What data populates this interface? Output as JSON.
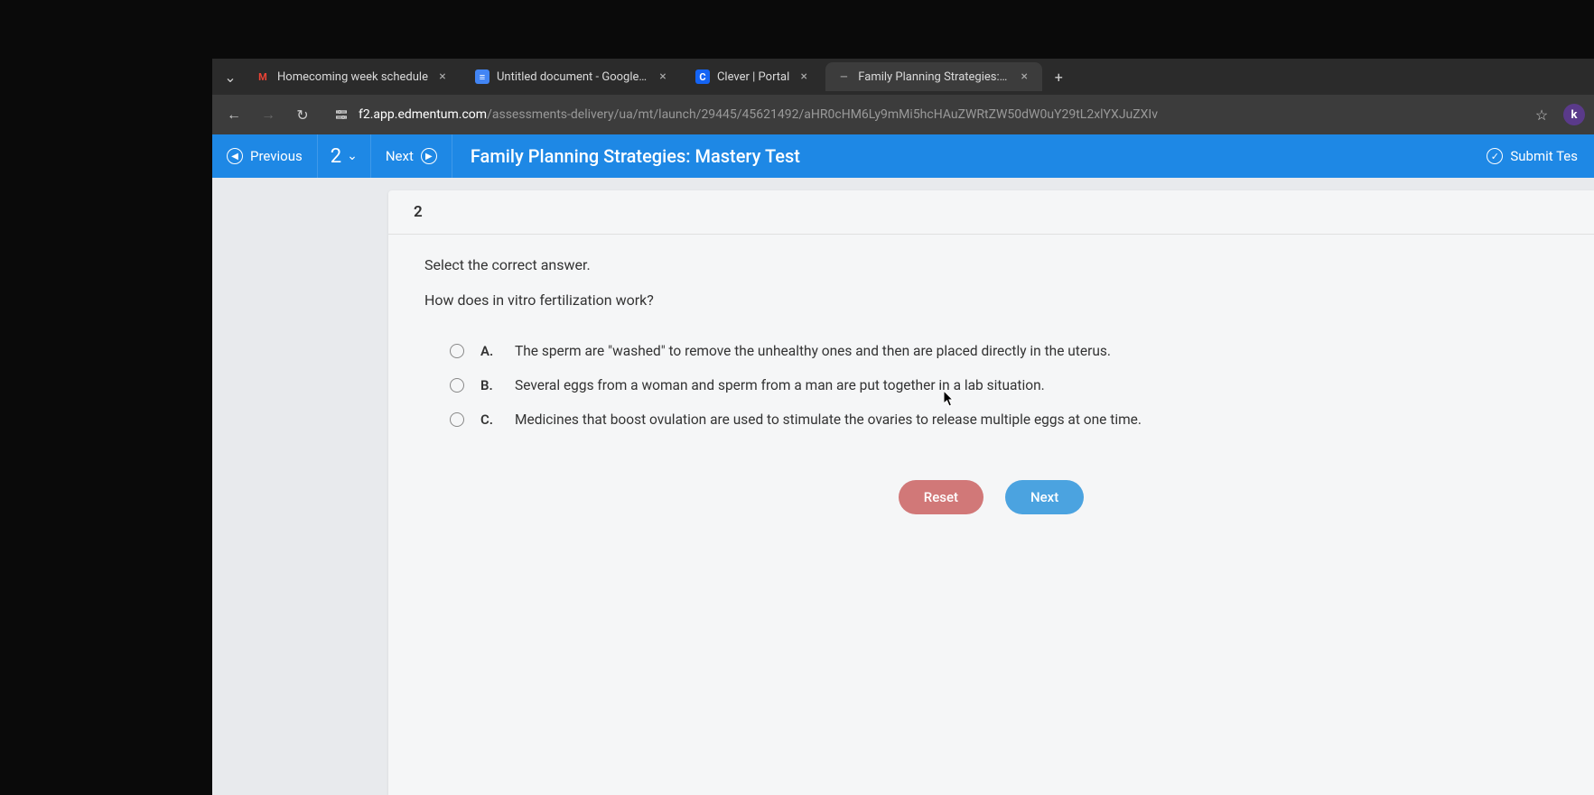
{
  "tabs": [
    {
      "favicon_letter": "M",
      "favicon_bg": "transparent",
      "favicon_color": "#ea4335",
      "title": "Homecoming week schedule"
    },
    {
      "favicon_letter": "≡",
      "favicon_bg": "#4285f4",
      "favicon_color": "#fff",
      "title": "Untitled document - Google D"
    },
    {
      "favicon_letter": "C",
      "favicon_bg": "#1464f4",
      "favicon_color": "#fff",
      "title": "Clever | Portal"
    },
    {
      "favicon_letter": "—",
      "favicon_bg": "transparent",
      "favicon_color": "#999",
      "title": "Family Planning Strategies: M"
    }
  ],
  "url": {
    "domain": "f2.app.edmentum.com",
    "path": "/assessments-delivery/ua/mt/launch/29445/45621492/aHR0cHM6Ly9mMi5hcHAuZWRtZW50dW0uY29tL2xlYXJuZXIv"
  },
  "ext_letter": "k",
  "header": {
    "previous": "Previous",
    "qnum": "2",
    "next": "Next",
    "title": "Family Planning Strategies: Mastery Test",
    "submit": "Submit Tes"
  },
  "question": {
    "number": "2",
    "instruction": "Select the correct answer.",
    "text": "How does in vitro fertilization work?",
    "options": [
      {
        "letter": "A.",
        "text": "The sperm are \"washed\" to remove the unhealthy ones and then are placed directly in the uterus."
      },
      {
        "letter": "B.",
        "text": "Several eggs from a woman and sperm from a man are put together in a lab situation."
      },
      {
        "letter": "C.",
        "text": "Medicines that boost ovulation are used to stimulate the ovaries to release multiple eggs at one time."
      }
    ],
    "reset_label": "Reset",
    "next_label": "Next"
  }
}
